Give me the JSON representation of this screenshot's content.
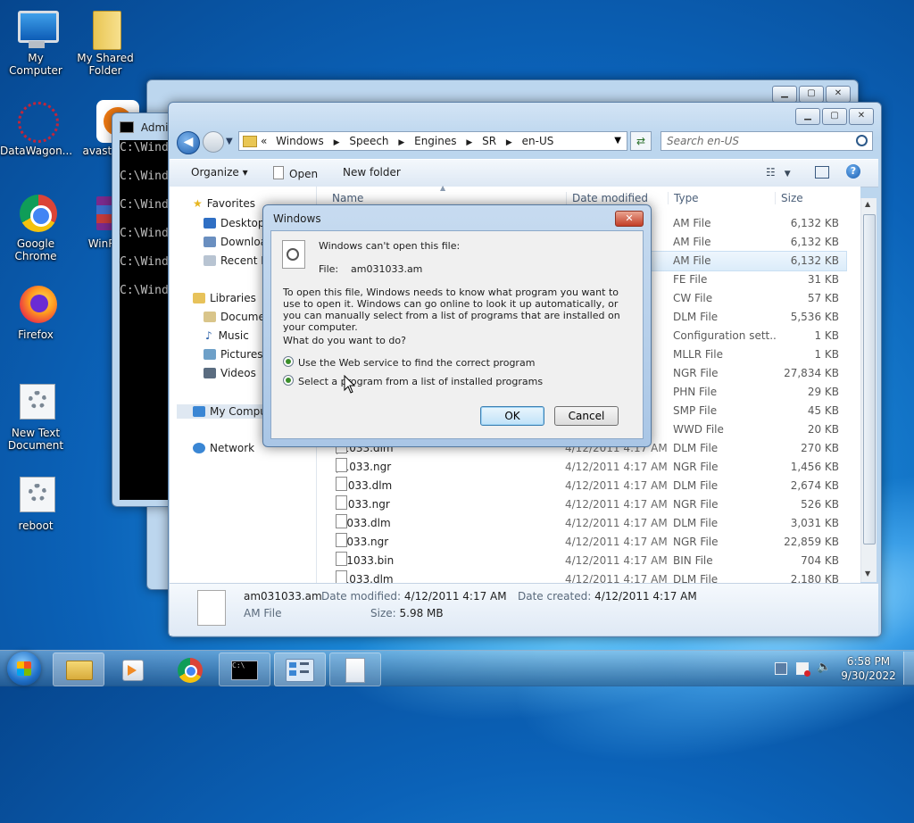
{
  "desktop": {
    "icons": [
      {
        "label": "My Computer",
        "icon": "computer-icon"
      },
      {
        "label": "My Shared Folder",
        "icon": "folder-icon"
      },
      {
        "label": "DataWagon...",
        "icon": "datawagon-icon"
      },
      {
        "label": "avast_or",
        "icon": "avast-icon"
      },
      {
        "label": "Google Chrome",
        "icon": "chrome-icon"
      },
      {
        "label": "WinRA",
        "icon": "winrar-icon"
      },
      {
        "label": "Firefox",
        "icon": "firefox-icon"
      },
      {
        "label": "New Text Document",
        "icon": "script-icon"
      },
      {
        "label": "reboot",
        "icon": "script-icon"
      }
    ]
  },
  "cmd": {
    "title": "Admin",
    "lines": [
      "C:\\Wind",
      "C:\\Wind",
      "C:\\Wind",
      "C:\\Wind",
      "C:\\Wind",
      "C:\\Wind"
    ]
  },
  "explorer": {
    "breadcrumb": [
      "«",
      "Windows",
      "Speech",
      "Engines",
      "SR",
      "en-US"
    ],
    "search_placeholder": "Search en-US",
    "toolbar": {
      "organize": "Organize ▾",
      "open": "Open",
      "new_folder": "New folder"
    },
    "nav": {
      "favorites": "Favorites",
      "desktop": "Desktop",
      "downloads": "Downloa",
      "recent": "Recent P",
      "libraries": "Libraries",
      "documents": "Docume",
      "music": "Music",
      "pictures": "Pictures",
      "videos": "Videos",
      "computer": "My Compu",
      "network": "Network"
    },
    "columns": {
      "name": "Name",
      "date": "Date modified",
      "type": "Type",
      "size": "Size"
    },
    "rows": [
      {
        "name": "",
        "date": "",
        "type": "AM File",
        "size": "6,132 KB"
      },
      {
        "name": "",
        "date": "",
        "type": "AM File",
        "size": "6,132 KB"
      },
      {
        "name": "",
        "date": "",
        "type": "AM File",
        "size": "6,132 KB"
      },
      {
        "name": "",
        "date": "",
        "type": "FE File",
        "size": "31 KB"
      },
      {
        "name": "",
        "date": "",
        "type": "CW File",
        "size": "57 KB"
      },
      {
        "name": "",
        "date": "",
        "type": "DLM File",
        "size": "5,536 KB"
      },
      {
        "name": "",
        "date": "",
        "type": "Configuration sett...",
        "size": "1 KB"
      },
      {
        "name": "",
        "date": "",
        "type": "MLLR File",
        "size": "1 KB"
      },
      {
        "name": "",
        "date": "",
        "type": "NGR File",
        "size": "27,834 KB"
      },
      {
        "name": "",
        "date": "",
        "type": "PHN File",
        "size": "29 KB"
      },
      {
        "name": "",
        "date": "",
        "type": "SMP File",
        "size": "45 KB"
      },
      {
        "name": "",
        "date": "",
        "type": "WWD File",
        "size": "20 KB"
      },
      {
        "name": "p1033.dlm",
        "date": "4/12/2011 4:17 AM",
        "type": "DLM File",
        "size": "270 KB"
      },
      {
        "name": "p1033.ngr",
        "date": "4/12/2011 4:17 AM",
        "type": "NGR File",
        "size": "1,456 KB"
      },
      {
        "name": "s1033.dlm",
        "date": "4/12/2011 4:17 AM",
        "type": "DLM File",
        "size": "2,674 KB"
      },
      {
        "name": "s1033.ngr",
        "date": "4/12/2011 4:17 AM",
        "type": "NGR File",
        "size": "526 KB"
      },
      {
        "name": "t1033.dlm",
        "date": "4/12/2011 4:17 AM",
        "type": "DLM File",
        "size": "3,031 KB"
      },
      {
        "name": "t1033.ngr",
        "date": "4/12/2011 4:17 AM",
        "type": "NGR File",
        "size": "22,859 KB"
      },
      {
        "name": "tn1033.bin",
        "date": "4/12/2011 4:17 AM",
        "type": "BIN File",
        "size": "704 KB"
      },
      {
        "name": "u1033.dlm",
        "date": "4/12/2011 4:17 AM",
        "type": "DLM File",
        "size": "2,180 KB"
      }
    ],
    "details": {
      "filename": "am031033.am",
      "filetype": "AM File",
      "modified_label": "Date modified:",
      "modified_value": "4/12/2011 4:17 AM",
      "created_label": "Date created:",
      "created_value": "4/12/2011 4:17 AM",
      "size_label": "Size:",
      "size_value": "5.98 MB"
    }
  },
  "dialog": {
    "title": "Windows",
    "heading": "Windows can't open this file:",
    "file_label": "File:",
    "file_name": "am031033.am",
    "body": "To open this file, Windows needs to know what program you want to use to open it. Windows can go online to look it up automatically, or you can manually select from a list of programs that are installed on your computer.",
    "question": "What do you want to do?",
    "option_web": "Use the Web service to find the correct program",
    "option_list": "Select a program from a list of installed programs",
    "ok": "OK",
    "cancel": "Cancel"
  },
  "taskbar": {
    "time": "6:58 PM",
    "date": "9/30/2022"
  },
  "colors": {
    "accent": "#2a6fc2",
    "selection": "#cce4f7",
    "dialog_frame": "#a9c6e6"
  }
}
